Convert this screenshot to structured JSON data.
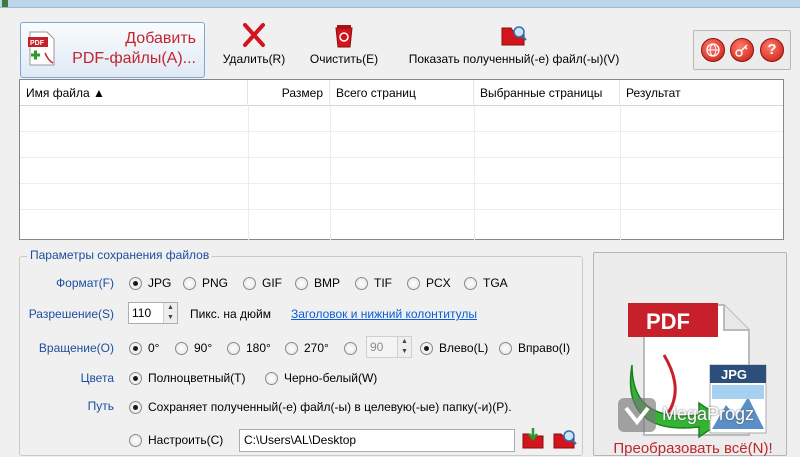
{
  "toolbar": {
    "add_label_line1": "Добавить",
    "add_label_line2": "PDF-файлы(A)...",
    "delete_label": "Удалить(R)",
    "clear_label": "Очистить(E)",
    "show_label": "Показать полученный(-е) файл(-ы)(V)"
  },
  "filelist": {
    "columns": [
      "Имя файла ▲",
      "Размер",
      "Всего страниц",
      "Выбранные страницы",
      "Результат"
    ]
  },
  "params": {
    "legend": "Параметры сохранения файлов",
    "format_label": "Формат(F)",
    "formats": [
      "JPG",
      "PNG",
      "GIF",
      "BMP",
      "TIF",
      "PCX",
      "TGA"
    ],
    "selected_format": "JPG",
    "resolution_label": "Разрешение(S)",
    "resolution_value": "110",
    "resolution_unit": "Пикс. на дюйм",
    "header_footer_link": "Заголовок и нижний колонтитулы",
    "rotation_label": "Вращение(O)",
    "rotations": [
      "0°",
      "90°",
      "180°",
      "270°"
    ],
    "rotation_custom_value": "90",
    "direction_left": "Влево(L)",
    "direction_right": "Вправо(I)",
    "colors_label": "Цвета",
    "color_full": "Полноцветный(T)",
    "color_bw": "Черно-белый(W)",
    "path_label": "Путь",
    "path_option_target": "Сохраняет полученный(-е) файл(-ы) в целевую(-ые) папку(-и)(P).",
    "path_option_custom": "Настроить(C)",
    "path_value": "C:\\Users\\AL\\Desktop"
  },
  "convert": {
    "label": "Преобразовать всё(N)!",
    "pdf_text": "PDF",
    "jpg_text": "JPG"
  },
  "watermark": {
    "text": "MegaProgz"
  },
  "colors": {
    "accent_red": "#c0262d",
    "label_blue": "#1c4ea0",
    "link_blue": "#0b5cd6"
  }
}
